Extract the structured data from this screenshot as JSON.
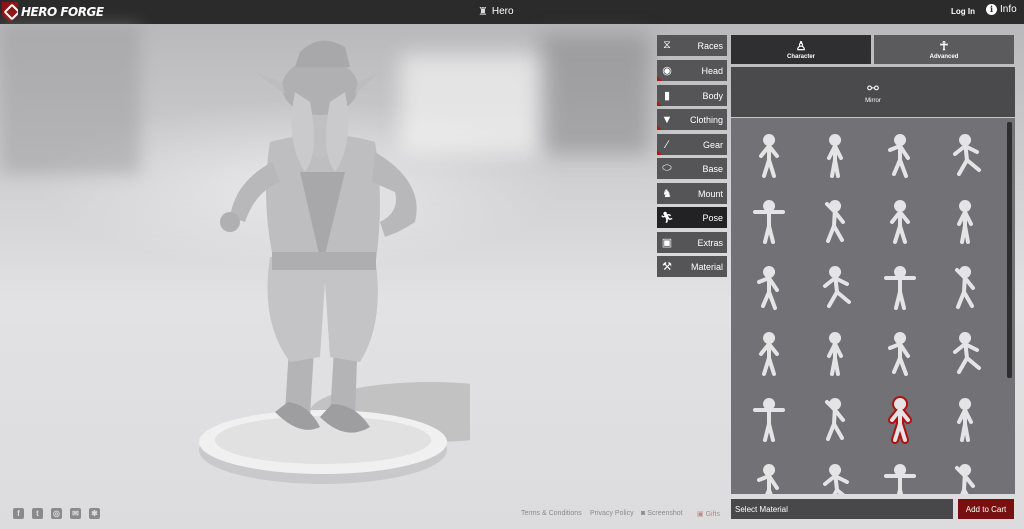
{
  "app": {
    "name": "HERO FORGE",
    "title": "Hero"
  },
  "header": {
    "login_label": "Log In",
    "info_label": "Info"
  },
  "tabs": [
    {
      "label": "Races",
      "icon": "dna-icon"
    },
    {
      "label": "Head",
      "icon": "head-icon"
    },
    {
      "label": "Body",
      "icon": "body-icon"
    },
    {
      "label": "Clothing",
      "icon": "shirt-icon"
    },
    {
      "label": "Gear",
      "icon": "sword-icon"
    },
    {
      "label": "Base",
      "icon": "base-icon"
    },
    {
      "label": "Mount",
      "icon": "horse-icon"
    },
    {
      "label": "Pose",
      "icon": "pose-icon"
    },
    {
      "label": "Extras",
      "icon": "gift-icon"
    },
    {
      "label": "Material",
      "icon": "material-icon"
    }
  ],
  "active_tab": "Pose",
  "panel": {
    "modes": [
      {
        "label": "Character",
        "active": true
      },
      {
        "label": "Advanced",
        "active": false
      }
    ],
    "mirror_label": "Mirror",
    "selected_pose_index": 18
  },
  "footer": {
    "select_material": "Select Material",
    "add_to_cart": "Add to Cart",
    "links": [
      "Terms & Conditions",
      "Privacy Policy",
      "Screenshot",
      "Gifts"
    ]
  },
  "colors": {
    "brand_red": "#8c1515",
    "cart": "#7a0f0f",
    "tab_bg": "#555558",
    "tab_active": "#222224"
  }
}
